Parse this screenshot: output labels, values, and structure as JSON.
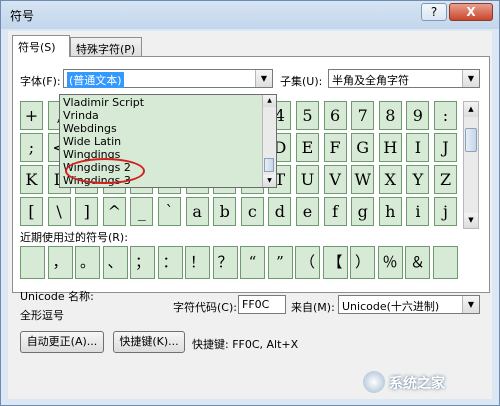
{
  "window": {
    "title": "符号",
    "help": "?",
    "close": "X"
  },
  "tabs": [
    {
      "label": "符号(S)"
    },
    {
      "label": "特殊字符(P)"
    }
  ],
  "font": {
    "label": "字体(F):",
    "value": "(普通文本)"
  },
  "subset": {
    "label": "子集(U):",
    "value": "半角及全角字符"
  },
  "dropdown_items": [
    "Vladimir Script",
    "Vrinda",
    "Webdings",
    "Wide Latin",
    "Wingdings",
    "Wingdings 2",
    "Wingdings 3"
  ],
  "grid_rows": [
    [
      "+",
      ",",
      "",
      "",
      "",
      "",
      "",
      "",
      "",
      "4",
      "5",
      "6",
      "7",
      "8",
      "9",
      ":"
    ],
    [
      ";",
      "<",
      "",
      "",
      "",
      "",
      "",
      "",
      "",
      "D",
      "E",
      "F",
      "G",
      "H",
      "I",
      "J"
    ],
    [
      "K",
      "L",
      "",
      "",
      "",
      "",
      "",
      "",
      "",
      "T",
      "U",
      "V",
      "W",
      "X",
      "Y",
      "Z"
    ],
    [
      "[",
      "\\",
      "]",
      "^",
      "_",
      "`",
      "a",
      "b",
      "c",
      "d",
      "e",
      "f",
      "g",
      "h",
      "i",
      "j"
    ]
  ],
  "recent": {
    "label": "近期使用过的符号(R):",
    "symbols": [
      "　",
      "，",
      "。",
      "、",
      "；",
      "：",
      "！",
      "？",
      "“",
      "”",
      "（",
      "【",
      "）",
      "％",
      "＆",
      "　"
    ]
  },
  "unicode_name": {
    "label": "Unicode 名称:",
    "value": "全形逗号"
  },
  "char_code": {
    "label": "字符代码(C):",
    "value": "FF0C"
  },
  "from": {
    "label": "来自(M):",
    "value": "Unicode(十六进制)"
  },
  "buttons": {
    "autocorrect": "自动更正(A)...",
    "shortcut": "快捷键(K)..."
  },
  "shortcut_info": "快捷键: FF0C, Alt+X",
  "watermark": "系统之家"
}
